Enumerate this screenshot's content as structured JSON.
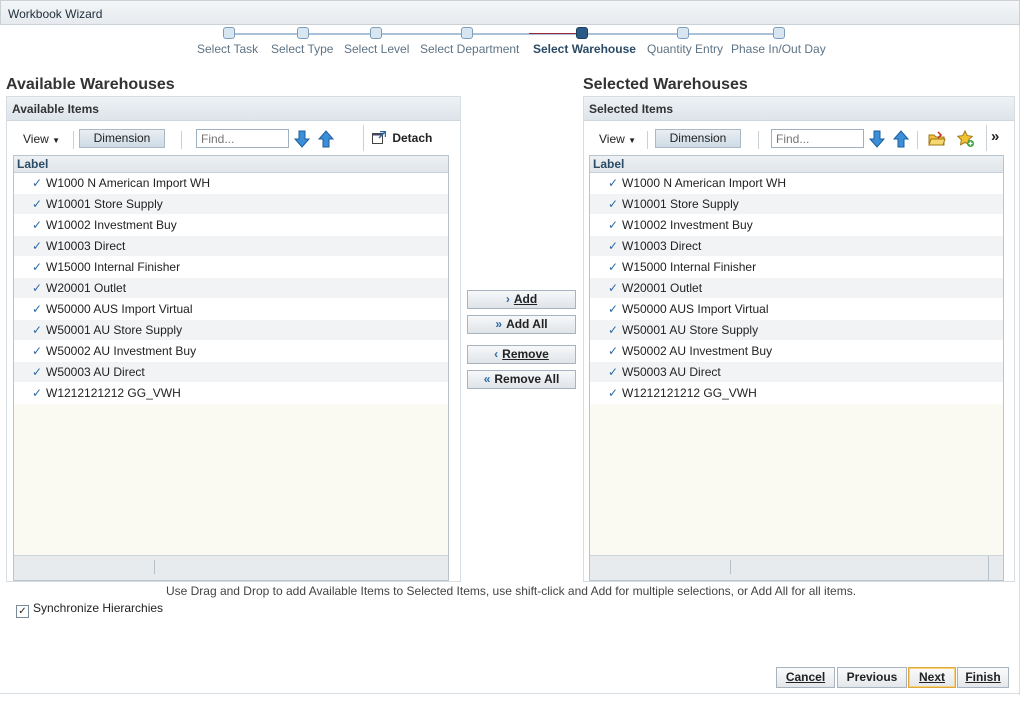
{
  "window": {
    "title": "Workbook Wizard"
  },
  "train": {
    "steps": [
      {
        "label": "Select Task"
      },
      {
        "label": "Select Type"
      },
      {
        "label": "Select Level"
      },
      {
        "label": "Select Department"
      },
      {
        "label": "Select Warehouse"
      },
      {
        "label": "Quantity Entry"
      },
      {
        "label": "Phase In/Out Day"
      }
    ],
    "current_index": 4
  },
  "available": {
    "section_title": "Available Warehouses",
    "panel_title": "Available Items",
    "view_label": "View",
    "dimension_label": "Dimension",
    "find_placeholder": "Find...",
    "detach_label": "Detach",
    "column_label": "Label",
    "items": [
      "W1000 N American Import WH",
      "W10001 Store Supply",
      "W10002 Investment Buy",
      "W10003 Direct",
      "W15000 Internal Finisher",
      "W20001 Outlet",
      "W50000 AUS Import Virtual",
      "W50001 AU Store Supply",
      "W50002 AU Investment Buy",
      "W50003 AU Direct",
      "W1212121212 GG_VWH"
    ]
  },
  "selected": {
    "section_title": "Selected Warehouses",
    "panel_title": "Selected Items",
    "view_label": "View",
    "dimension_label": "Dimension",
    "find_placeholder": "Find...",
    "more_label": "»",
    "column_label": "Label",
    "items": [
      "W1000 N American Import WH",
      "W10001 Store Supply",
      "W10002 Investment Buy",
      "W10003 Direct",
      "W15000 Internal Finisher",
      "W20001 Outlet",
      "W50000 AUS Import Virtual",
      "W50001 AU Store Supply",
      "W50002 AU Investment Buy",
      "W50003 AU Direct",
      "W1212121212 GG_VWH"
    ]
  },
  "shuttle": {
    "add": "Add",
    "add_all": "Add All",
    "remove": "Remove",
    "remove_all": "Remove All"
  },
  "hint_text": "Use Drag and Drop to add Available Items to Selected Items, use shift-click and Add for multiple selections, or Add All for all items.",
  "sync_label": "Synchronize Hierarchies",
  "sync_checked": true,
  "footer": {
    "cancel": "Cancel",
    "previous": "Previous",
    "next": "Next",
    "finish": "Finish"
  }
}
